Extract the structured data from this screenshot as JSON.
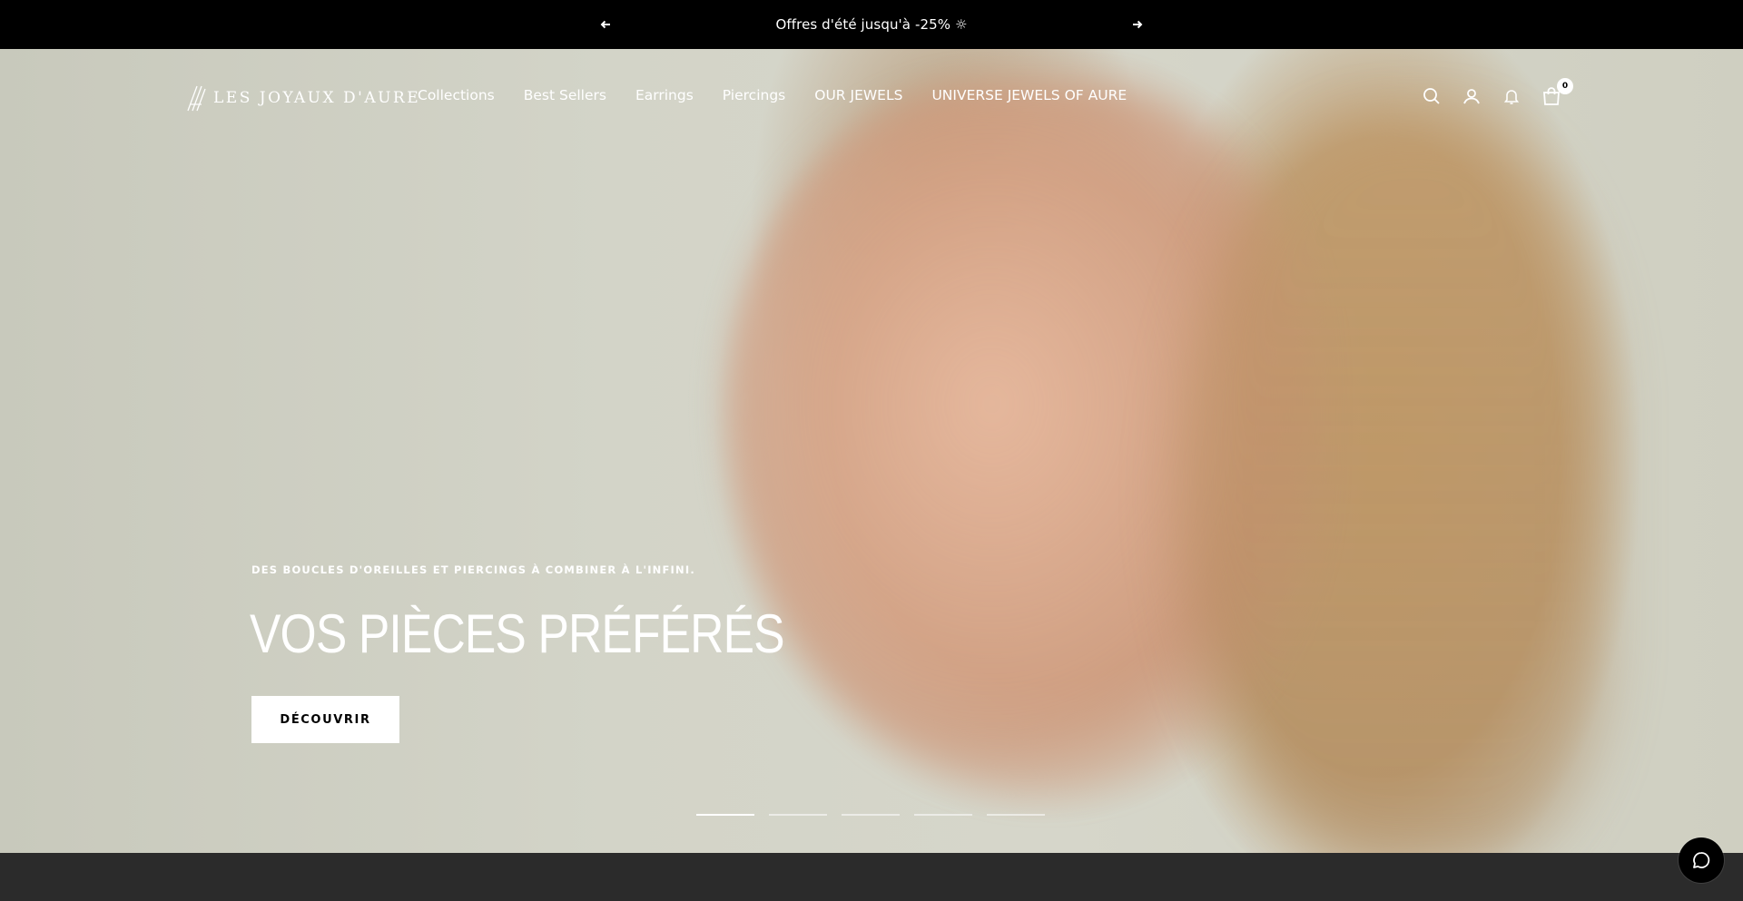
{
  "announcement": {
    "text": "Offres d'été jusqu'à -25% ☼",
    "prev_icon": "arrow-left-icon",
    "next_icon": "arrow-right-icon"
  },
  "header": {
    "logo_text": "LES JOYAUX D'AURE",
    "nav": [
      {
        "label": "Collections"
      },
      {
        "label": "Best Sellers"
      },
      {
        "label": "Earrings"
      },
      {
        "label": "Piercings"
      },
      {
        "label": "OUR JEWELS"
      },
      {
        "label": "UNIVERSE JEWELS OF AURE"
      }
    ],
    "icons": [
      "search-icon",
      "account-icon",
      "bell-icon",
      "cart-icon"
    ],
    "cart_count": "0"
  },
  "hero": {
    "subtitle": "DES BOUCLES D'OREILLES ET PIERCINGS À COMBINER À L'INFINI.",
    "title": "VOS PIÈCES PRÉFÉRÉS",
    "button_label": "DÉCOUVRIR",
    "slides_total": 5,
    "active_slide": 1
  },
  "chat": {
    "icon": "chat-bubble-icon"
  },
  "colors": {
    "announcement_bg": "#000000",
    "text": "#ffffff",
    "bottom_band": "#2b2b2b"
  }
}
